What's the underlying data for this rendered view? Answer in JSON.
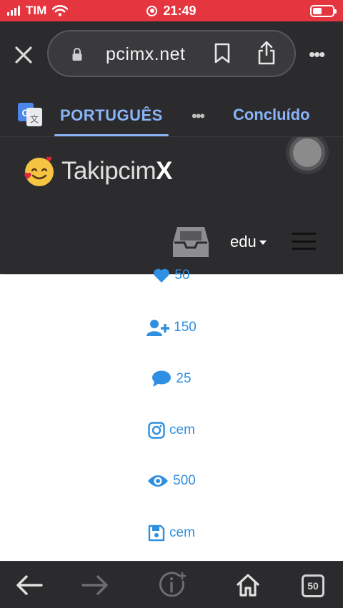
{
  "status_bar": {
    "carrier": "TIM",
    "time": "21:49"
  },
  "browser": {
    "url_display": "pcimx.net"
  },
  "translate_bar": {
    "language": "PORTUGUÊS",
    "more": "•••",
    "done": "Concluído"
  },
  "site": {
    "logo_text": "Takipcim",
    "logo_text_bold": "X",
    "user_name": "edu"
  },
  "stats": [
    {
      "icon": "heart-icon",
      "value": "50"
    },
    {
      "icon": "user-plus-icon",
      "value": "150"
    },
    {
      "icon": "comment-icon",
      "value": "25"
    },
    {
      "icon": "instagram-icon",
      "value": "cem"
    },
    {
      "icon": "eye-icon",
      "value": "500"
    },
    {
      "icon": "save-icon",
      "value": "cem"
    }
  ],
  "toolbar": {
    "tabs_count": "50"
  },
  "colors": {
    "status_bar": "#e5353f",
    "chrome": "#2b2b2d",
    "link_blue": "#8ab4f8",
    "stat_blue": "#2f8fe0"
  }
}
